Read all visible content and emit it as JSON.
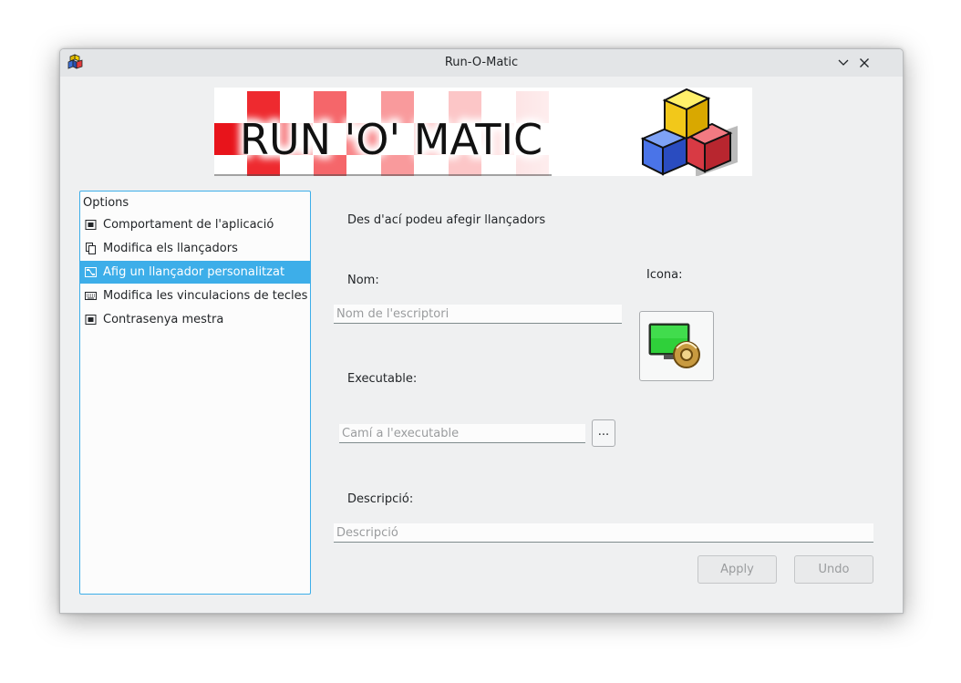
{
  "window": {
    "title": "Run-O-Matic"
  },
  "banner": {
    "logo_text": "RUN 'O' MATIC"
  },
  "options": {
    "header": "Options",
    "items": [
      {
        "label": "Comportament de l'aplicació",
        "icon": "window-icon"
      },
      {
        "label": "Modifica els llançadors",
        "icon": "copy-icon"
      },
      {
        "label": "Afig un llançador personalitzat",
        "icon": "network-icon",
        "selected": true
      },
      {
        "label": "Modifica les vinculacions de tecles",
        "icon": "keyboard-icon"
      },
      {
        "label": "Contrasenya mestra",
        "icon": "window-icon"
      }
    ]
  },
  "form": {
    "intro": "Des d'ací podeu afegir llançadors",
    "name_label": "Nom:",
    "name_placeholder": "Nom de l'escriptori",
    "icon_label": "Icona:",
    "exec_label": "Executable:",
    "exec_placeholder": "Camí a l'executable",
    "browse_label": "...",
    "desc_label": "Descripció:",
    "desc_placeholder": "Descripció",
    "apply_label": "Apply",
    "undo_label": "Undo"
  },
  "colors": {
    "accent": "#3daee9",
    "window_bg": "#eff0f1",
    "banner_red": "#e8141b"
  }
}
